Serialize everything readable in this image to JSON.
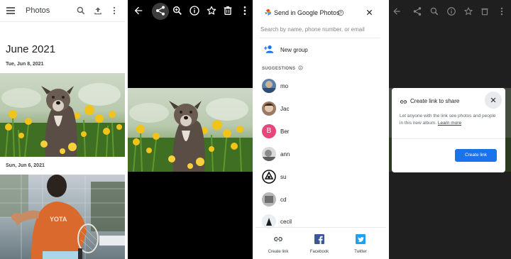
{
  "photos_panel": {
    "title": "Photos",
    "month": "June 2021",
    "date_1": "Tue, Jun 8, 2021",
    "date_2": "Sun, Jun 6, 2021"
  },
  "send_panel": {
    "title": "Send in Google Photos",
    "search_placeholder": "Search by name, phone number, or email",
    "new_group": "New group",
    "suggestions_label": "SUGGESTIONS",
    "contacts": [
      {
        "name": "mo"
      },
      {
        "name": "Jac"
      },
      {
        "name": "Ber",
        "initial": "B",
        "color": "#e8457c"
      },
      {
        "name": "ann"
      },
      {
        "name": "su"
      },
      {
        "name": "cd"
      },
      {
        "name": "cecil"
      }
    ],
    "actions": {
      "create_link": "Create link",
      "facebook": "Facebook",
      "twitter": "Twitter"
    }
  },
  "dialog": {
    "title": "Create link to share",
    "body": "Let anyone with the link see photos and people in this new album.",
    "learn_more": "Learn more",
    "button": "Create link"
  },
  "colors": {
    "accent": "#1a73e8",
    "facebook": "#3b5998",
    "twitter": "#1da1f2"
  }
}
